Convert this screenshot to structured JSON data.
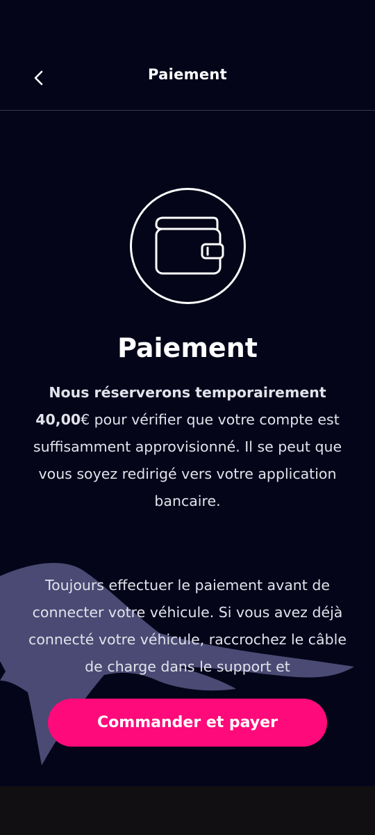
{
  "header": {
    "title": "Paiement",
    "back_icon": "chevron-left-icon"
  },
  "hero": {
    "icon": "wallet-icon",
    "title": "Paiement"
  },
  "content": {
    "p1_bold": "Nous réserverons temporairement 40,00",
    "p1_rest": "€ pour vérifier que votre compte est suffisamment approvisionné. Il se peut que vous soyez redirigé vers votre application bancaire.",
    "p2": "Toujours effectuer le paiement avant de connecter votre véhicule. Si vous avez déjà connecté votre véhicule, raccrochez le câble de charge dans le support et"
  },
  "cta": {
    "label": "Commander et payer"
  },
  "colors": {
    "background": "#05051a",
    "accent": "#ff0a7a",
    "decor": "#4a4a74",
    "bottom_bar": "#110f12"
  }
}
